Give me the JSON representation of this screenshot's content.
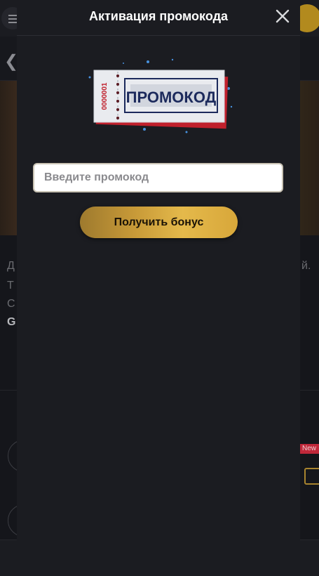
{
  "modal": {
    "title": "Активация промокода",
    "promo_art_text": "ПРОМОКОД",
    "promo_art_serial": "0000001",
    "input_placeholder": "Введите промокод",
    "input_value": "",
    "submit_label": "Получить бонус"
  },
  "background": {
    "text_lines": [
      "Д",
      "Т",
      "С",
      "G"
    ],
    "right_fragment": "й.",
    "new_badge": "New"
  },
  "icons": {
    "close": "close-icon",
    "menu": "menu-icon",
    "back": "chevron-left-icon",
    "gift": "gift-icon"
  },
  "colors": {
    "modal_bg": "#1b1c21",
    "accent_gold": "#e4b94b",
    "ticket_red": "#c0202c",
    "ticket_navy": "#1c2a5c"
  }
}
